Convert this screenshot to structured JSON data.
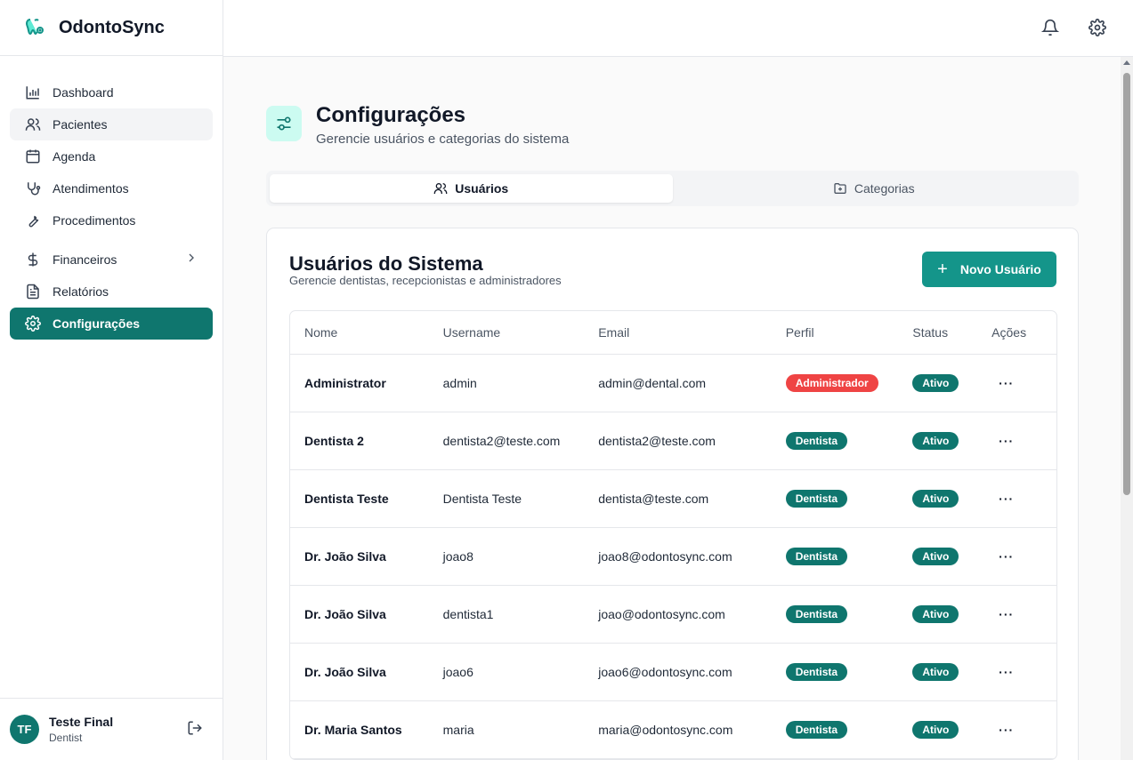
{
  "brand": {
    "name": "OdontoSync"
  },
  "sidebar": {
    "items": [
      {
        "label": "Dashboard",
        "icon": "chart-icon"
      },
      {
        "label": "Pacientes",
        "icon": "users-icon"
      },
      {
        "label": "Agenda",
        "icon": "calendar-icon"
      },
      {
        "label": "Atendimentos",
        "icon": "stethoscope-icon"
      },
      {
        "label": "Procedimentos",
        "icon": "wrench-icon"
      },
      {
        "label": "Financeiros",
        "icon": "dollar-icon"
      },
      {
        "label": "Relatórios",
        "icon": "document-icon"
      },
      {
        "label": "Configurações",
        "icon": "gear-icon"
      }
    ]
  },
  "user": {
    "initials": "TF",
    "name": "Teste Final",
    "role": "Dentist"
  },
  "page": {
    "title": "Configurações",
    "subtitle": "Gerencie usuários e categorias do sistema"
  },
  "tabs": [
    {
      "label": "Usuários"
    },
    {
      "label": "Categorias"
    }
  ],
  "card": {
    "title": "Usuários do Sistema",
    "subtitle": "Gerencie dentistas, recepcionistas e administradores",
    "new_button": "Novo Usuário"
  },
  "table": {
    "headers": [
      "Nome",
      "Username",
      "Email",
      "Perfil",
      "Status",
      "Ações"
    ],
    "rows": [
      {
        "nome": "Administrator",
        "username": "admin",
        "email": "admin@dental.com",
        "perfil": "Administrador",
        "status": "Ativo",
        "acoes": "···"
      },
      {
        "nome": "Dentista 2",
        "username": "dentista2@teste.com",
        "email": "dentista2@teste.com",
        "perfil": "Dentista",
        "status": "Ativo",
        "acoes": "···"
      },
      {
        "nome": "Dentista Teste",
        "username": "Dentista Teste",
        "email": "dentista@teste.com",
        "perfil": "Dentista",
        "status": "Ativo",
        "acoes": "···"
      },
      {
        "nome": "Dr. João Silva",
        "username": "joao8",
        "email": "joao8@odontosync.com",
        "perfil": "Dentista",
        "status": "Ativo",
        "acoes": "···"
      },
      {
        "nome": "Dr. João Silva",
        "username": "dentista1",
        "email": "joao@odontosync.com",
        "perfil": "Dentista",
        "status": "Ativo",
        "acoes": "···"
      },
      {
        "nome": "Dr. João Silva",
        "username": "joao6",
        "email": "joao6@odontosync.com",
        "perfil": "Dentista",
        "status": "Ativo",
        "acoes": "···"
      },
      {
        "nome": "Dr. Maria Santos",
        "username": "maria",
        "email": "maria@odontosync.com",
        "perfil": "Dentista",
        "status": "Ativo",
        "acoes": "···"
      }
    ]
  },
  "colors": {
    "accent": "#0f766e",
    "button": "#14958a",
    "admin_badge": "#ef4444",
    "icon_bg": "#ccfbf1"
  }
}
